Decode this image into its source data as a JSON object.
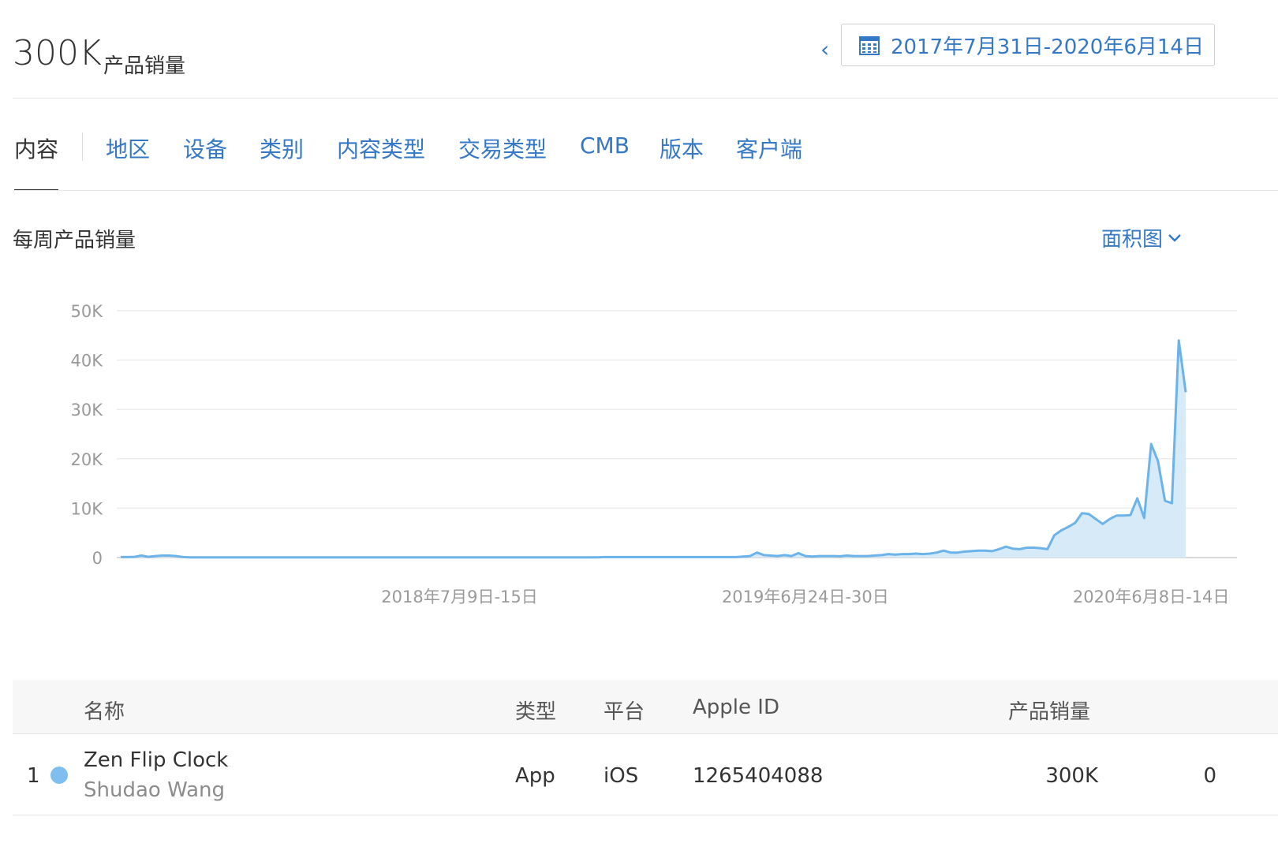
{
  "header": {
    "total_value": "300K",
    "total_label": "产品销量",
    "prev_label": "‹",
    "date_range": "2017年7月31日-2020年6月14日"
  },
  "tabs": [
    {
      "label": "内容",
      "active": true
    },
    {
      "label": "地区"
    },
    {
      "label": "设备"
    },
    {
      "label": "类别"
    },
    {
      "label": "内容类型"
    },
    {
      "label": "交易类型"
    },
    {
      "label": "CMB"
    },
    {
      "label": "版本"
    },
    {
      "label": "客户端"
    }
  ],
  "section": {
    "title": "每周产品销量",
    "chart_type_label": "面积图"
  },
  "colors": {
    "accent": "#3478c6",
    "series_line": "#6cb3ea",
    "series_fill": "#d7eaf8"
  },
  "chart_data": {
    "type": "area",
    "x_start": "2017-07-31",
    "x_interval": "week",
    "ylim": [
      0,
      50000
    ],
    "yticks": [
      {
        "value": 0,
        "label": "0"
      },
      {
        "value": 10000,
        "label": "10K"
      },
      {
        "value": 20000,
        "label": "20K"
      },
      {
        "value": 30000,
        "label": "30K"
      },
      {
        "value": 40000,
        "label": "40K"
      },
      {
        "value": 50000,
        "label": "50K"
      }
    ],
    "xticks": [
      {
        "week_index": 49,
        "label": "2018年7月9日-15日"
      },
      {
        "week_index": 99,
        "label": "2019年6月24日-30日"
      },
      {
        "week_index": 149,
        "label": "2020年6月8日-14日"
      }
    ],
    "values": [
      100,
      100,
      150,
      400,
      150,
      300,
      400,
      400,
      300,
      100,
      50,
      50,
      50,
      50,
      50,
      50,
      50,
      50,
      50,
      50,
      50,
      50,
      50,
      50,
      50,
      50,
      50,
      50,
      50,
      50,
      50,
      50,
      50,
      50,
      50,
      50,
      50,
      50,
      50,
      50,
      50,
      50,
      50,
      50,
      50,
      50,
      50,
      50,
      50,
      50,
      50,
      50,
      50,
      50,
      50,
      50,
      50,
      50,
      50,
      50,
      50,
      50,
      50,
      50,
      50,
      50,
      50,
      50,
      50,
      50,
      100,
      100,
      100,
      100,
      100,
      100,
      100,
      100,
      100,
      100,
      100,
      100,
      100,
      100,
      100,
      100,
      100,
      100,
      100,
      100,
      200,
      300,
      1000,
      500,
      400,
      300,
      500,
      300,
      900,
      300,
      200,
      300,
      300,
      300,
      250,
      400,
      300,
      300,
      300,
      400,
      500,
      700,
      600,
      700,
      700,
      800,
      700,
      800,
      1000,
      1400,
      1000,
      1000,
      1200,
      1300,
      1400,
      1400,
      1300,
      1700,
      2200,
      1800,
      1700,
      2000,
      2000,
      1900,
      1700,
      4500,
      5500,
      6200,
      7000,
      9000,
      8800,
      7800,
      6800,
      7800,
      8500,
      8500,
      8600,
      12000,
      8000,
      23000,
      19500,
      11500,
      11000,
      44000,
      33500
    ]
  },
  "table": {
    "headers": {
      "name": "名称",
      "type": "类型",
      "platform": "平台",
      "apple_id": "Apple ID",
      "sales": "产品销量"
    },
    "rows": [
      {
        "rank": "1",
        "name": "Zen Flip Clock",
        "developer": "Shudao Wang",
        "type": "App",
        "platform": "iOS",
        "apple_id": "1265404088",
        "sales": "300K",
        "extra": "0"
      }
    ]
  }
}
